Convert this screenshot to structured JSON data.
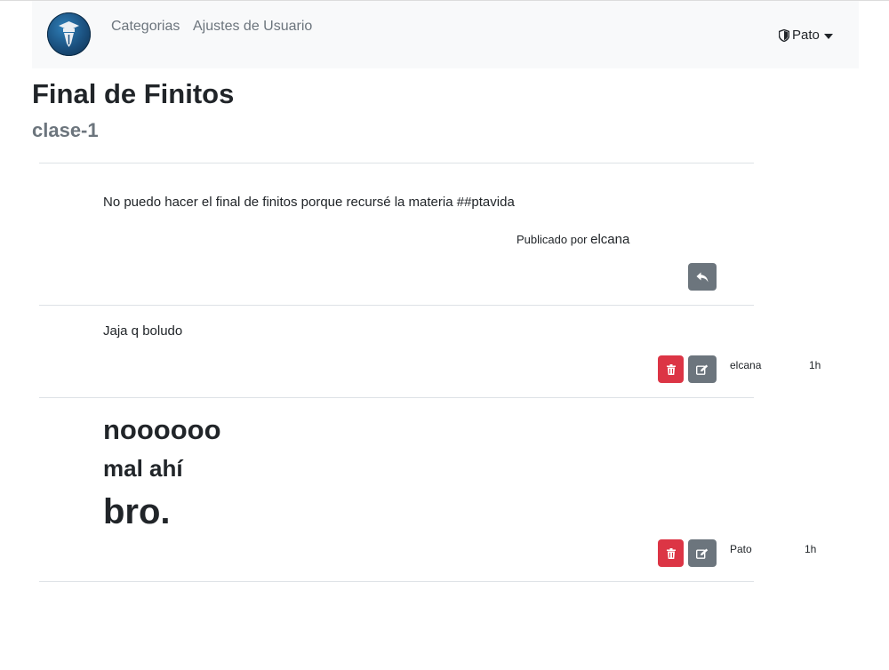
{
  "nav": {
    "links": [
      "Categorias",
      "Ajustes de Usuario"
    ],
    "user": "Pato"
  },
  "page": {
    "title": "Final de Finitos",
    "subtitle": "clase-1"
  },
  "post": {
    "body": "No puedo hacer el final de finitos porque recursé la materia ##ptavida",
    "published_label": "Publicado por",
    "author": "elcana"
  },
  "comments": [
    {
      "text": "Jaja q boludo",
      "author": "elcana",
      "time": "1h"
    },
    {
      "lines": [
        "noooooo",
        "mal ahí",
        "bro."
      ],
      "author": "Pato",
      "time": "1h"
    }
  ],
  "colors": {
    "navbar_bg": "#f8f9fa",
    "danger": "#dc3545",
    "secondary": "#6c757d"
  },
  "icons": {
    "logo": "graduation-pen-logo",
    "user": "shield-icon",
    "reply": "reply-icon",
    "delete": "trash-icon",
    "edit": "edit-icon"
  }
}
